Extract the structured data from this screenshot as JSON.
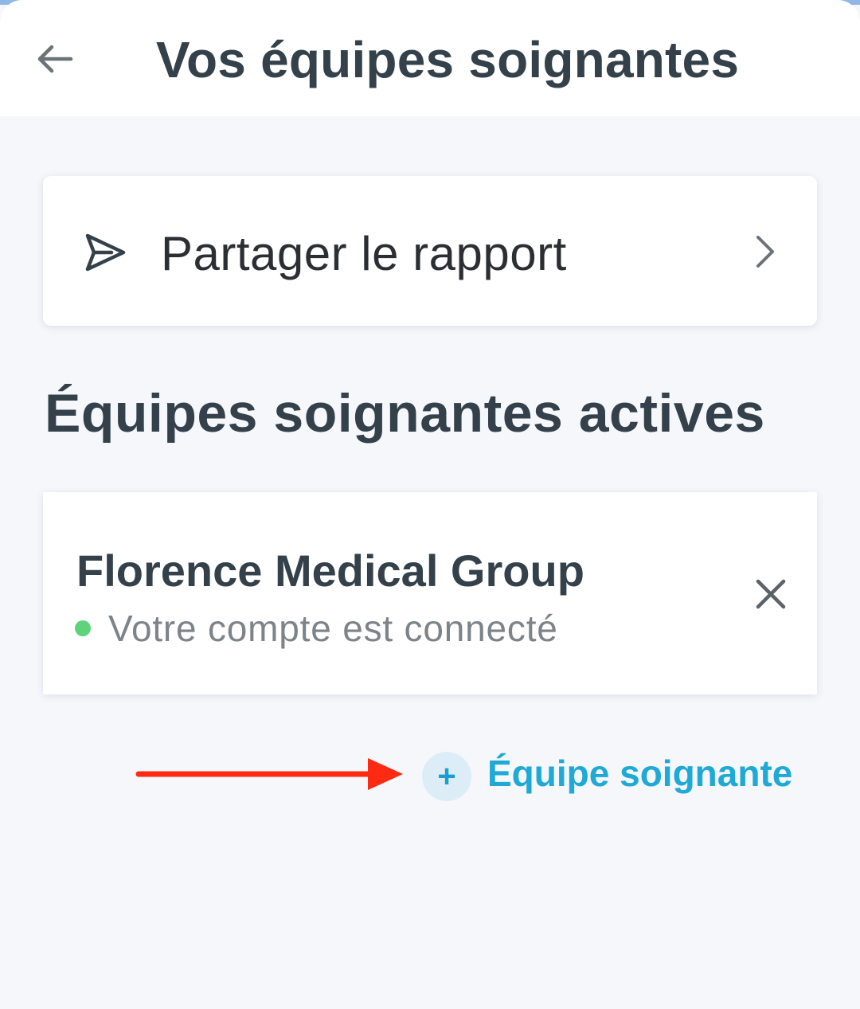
{
  "header": {
    "title": "Vos équipes soignantes",
    "back_icon": "arrow-left-icon"
  },
  "share_report": {
    "label": "Partager le rapport",
    "icon": "send-icon",
    "trailing_icon": "chevron-right-icon"
  },
  "active_teams": {
    "title": "Équipes soignantes actives",
    "items": [
      {
        "name": "Florence Medical Group",
        "status": "Votre compte est connecté",
        "status_color": "#5fd37a",
        "remove_icon": "close-icon"
      }
    ]
  },
  "add_team": {
    "plus": "+",
    "label": "Équipe soignante",
    "color": "#1fa9d6"
  },
  "annotation": {
    "icon": "red-arrow-icon",
    "color": "#ff2a12"
  }
}
